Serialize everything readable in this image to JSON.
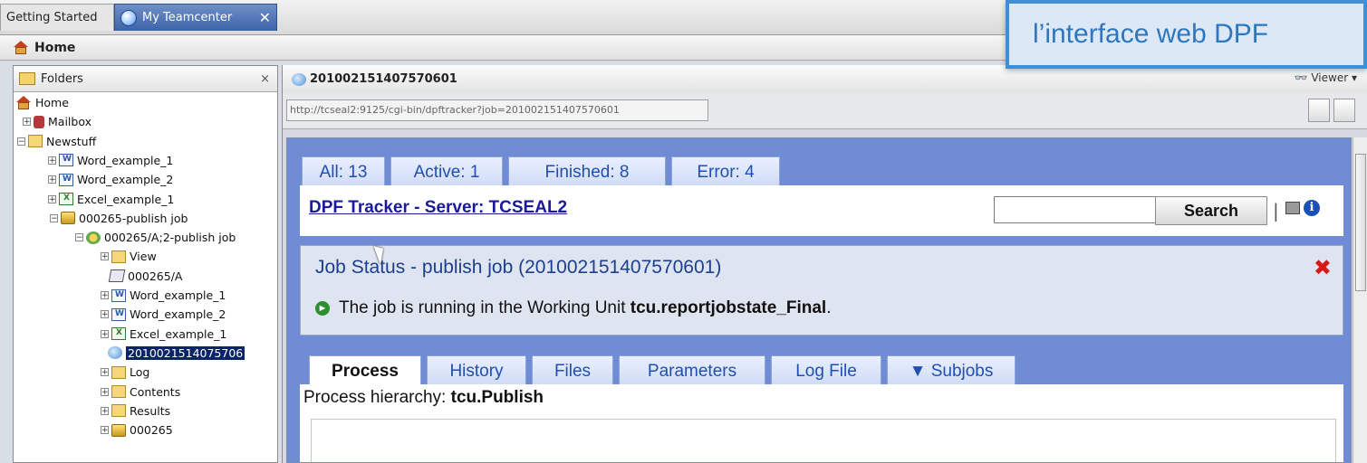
{
  "tabs": {
    "getting_started": "Getting Started",
    "my_teamcenter": "My Teamcenter",
    "close": "✕"
  },
  "home_bar": {
    "label": "Home"
  },
  "callout": {
    "text": "l’interface web DPF"
  },
  "left_pane": {
    "title": "Folders",
    "close": "×",
    "tree": [
      {
        "label": "Home",
        "icon": "home-icon"
      },
      {
        "label": "Mailbox",
        "icon": "mailbox-icon"
      },
      {
        "label": "Newstuff",
        "icon": "folder-icon"
      },
      {
        "label": "Word_example_1",
        "icon": "word-icon"
      },
      {
        "label": "Word_example_2",
        "icon": "word-icon"
      },
      {
        "label": "Excel_example_1",
        "icon": "excel-icon"
      },
      {
        "label": "000265-publish job",
        "icon": "item-icon"
      },
      {
        "label": "000265/A;2-publish job",
        "icon": "revision-icon"
      },
      {
        "label": "View",
        "icon": "folder-icon"
      },
      {
        "label": "000265/A",
        "icon": "dataset-icon"
      },
      {
        "label": "Word_example_1",
        "icon": "word-icon"
      },
      {
        "label": "Word_example_2",
        "icon": "word-icon"
      },
      {
        "label": "Excel_example_1",
        "icon": "excel-icon"
      },
      {
        "label": "2010021514075706",
        "icon": "job-icon",
        "selected": true
      },
      {
        "label": "Log",
        "icon": "folder-icon"
      },
      {
        "label": "Contents",
        "icon": "folder-icon"
      },
      {
        "label": "Results",
        "icon": "folder-icon"
      },
      {
        "label": "000265",
        "icon": "item-icon"
      }
    ]
  },
  "right_pane": {
    "title": "201002151407570601",
    "viewer": "Viewer",
    "url": "http://tcseal2:9125/cgi-bin/dpftracker?job=201002151407570601"
  },
  "tracker": {
    "count_tabs": [
      "All: 13",
      "Active: 1",
      "Finished: 8",
      "Error: 4"
    ],
    "server_link": "DPF Tracker - Server: TCSEAL2",
    "search_button": "Search",
    "separator": "|",
    "info": "i",
    "status_title": "Job Status - publish job (201002151407570601)",
    "status_close": "✖",
    "status_prefix": "The job is running in the Working Unit ",
    "status_unit": "tcu.reportjobstate_Final",
    "status_suffix": ".",
    "detail_tabs": [
      "Process",
      "History",
      "Files",
      "Parameters",
      "Log File",
      "▼ Subjobs"
    ],
    "process_label": "Process hierarchy: ",
    "process_value": "tcu.Publish"
  },
  "colors": {
    "accent": "#3f8fd2",
    "web_bg": "#6f8cd4",
    "link": "#1a1a9a",
    "close_red": "#d71818"
  }
}
